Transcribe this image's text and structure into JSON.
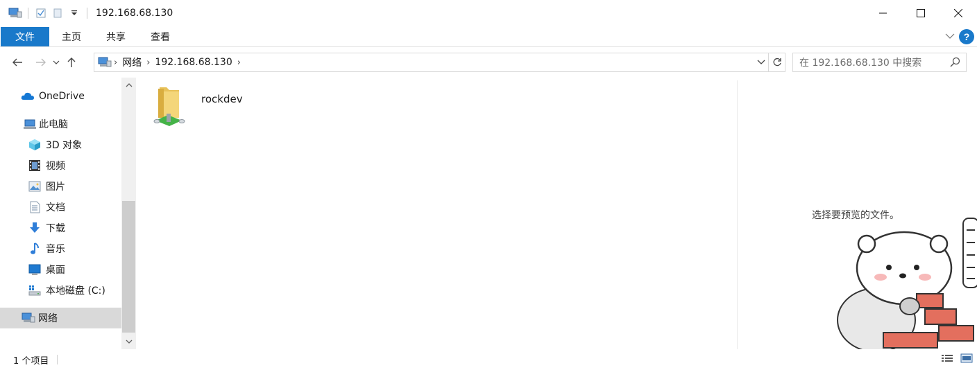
{
  "window": {
    "title": "192.168.68.130"
  },
  "ribbon": {
    "tabs": [
      "文件",
      "主页",
      "共享",
      "查看"
    ],
    "help_label": "?"
  },
  "address": {
    "crumbs": [
      "网络",
      "192.168.68.130"
    ]
  },
  "search": {
    "placeholder": "在 192.168.68.130 中搜索"
  },
  "sidebar": {
    "items": [
      {
        "label": "OneDrive",
        "icon": "onedrive-icon"
      },
      {
        "label": "此电脑",
        "icon": "computer-icon"
      },
      {
        "label": "3D 对象",
        "icon": "3d-objects-icon"
      },
      {
        "label": "视频",
        "icon": "video-icon"
      },
      {
        "label": "图片",
        "icon": "pictures-icon"
      },
      {
        "label": "文档",
        "icon": "documents-icon"
      },
      {
        "label": "下载",
        "icon": "download-icon"
      },
      {
        "label": "音乐",
        "icon": "music-icon"
      },
      {
        "label": "桌面",
        "icon": "desktop-icon"
      },
      {
        "label": "本地磁盘 (C:)",
        "icon": "drive-icon"
      },
      {
        "label": "网络",
        "icon": "network-icon",
        "selected": true
      }
    ]
  },
  "content": {
    "items": [
      {
        "name": "rockdev",
        "icon": "network-share-folder-icon"
      }
    ]
  },
  "preview": {
    "message": "选择要预览的文件。"
  },
  "status": {
    "item_count": "1 个项目"
  },
  "colors": {
    "accent": "#1979ca",
    "selected_bg": "#d9d9d9"
  }
}
